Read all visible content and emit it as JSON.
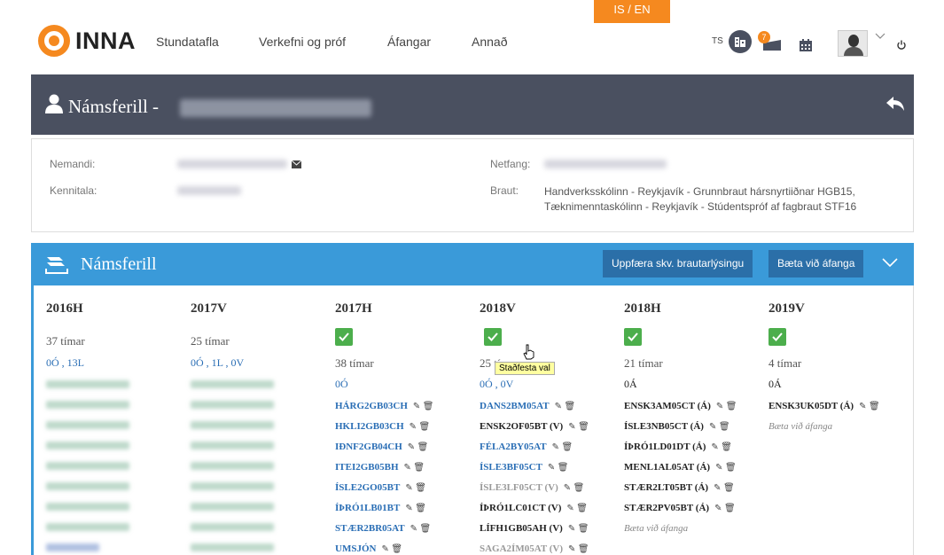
{
  "lang_switch": "IS / EN",
  "app": {
    "logo_text": "INNA"
  },
  "nav": [
    "Stundatafla",
    "Verkefni og próf",
    "Áfangar",
    "Annað"
  ],
  "topbar": {
    "ts_label": "TS",
    "notif_count": "7"
  },
  "header": {
    "title": "Námsferill -"
  },
  "info": {
    "nemandi_label": "Nemandi:",
    "kennitala_label": "Kennitala:",
    "netfang_label": "Netfang:",
    "braut_label": "Braut:",
    "braut_value_1": "Handverksskólinn - Reykjavík - Grunnbraut hársnyrtiiðnar HGB15,",
    "braut_value_2": "Tæknimenntaskólinn - Reykjavík - Stúdentspróf af fagbraut STF16"
  },
  "panel": {
    "title": "Námsferill",
    "update_button": "Uppfæra skv. brautarlýsingu",
    "add_button": "Bæta við áfanga"
  },
  "columns": [
    {
      "year": "2016H",
      "hours": "37 tímar",
      "counts": "0Ó , 13L"
    },
    {
      "year": "2017V",
      "hours": "25 tímar",
      "counts": "0Ó , 1L , 0V"
    },
    {
      "year": "2017H",
      "hours": "38 tímar",
      "counts": "0Ó",
      "courses": [
        "HÁRG2GB03CH",
        "HKLI2GB03CH",
        "IÐNF2GB04CH",
        "ITEI2GB05BH",
        "ÍSLE2GO05BT",
        "ÍÞRÓ1LB01BT",
        "STÆR2BR05AT",
        "UMSJÓN"
      ]
    },
    {
      "year": "2018V",
      "hours": "25 tímar",
      "counts": "0Ó , 0V",
      "courses": [
        "DANS2BM05AT",
        "ENSK2OF05BT (V)",
        "FÉLA2BY05AT",
        "ÍSLE3BF05CT",
        "ÍSLE3LF05CT (V)",
        "ÍÞRÓ1LC01CT (V)",
        "LÍFH1GB05AH (V)",
        "SAGA2ÍM05AT (V)"
      ]
    },
    {
      "year": "2018H",
      "hours": "21 tímar",
      "counts": "0Á",
      "courses": [
        "ENSK3AM05CT (Á)",
        "ÍSLE3NB05CT (Á)",
        "ÍÞRÓ1LD01DT (Á)",
        "MENL1AL05AT (Á)",
        "STÆR2LT05BT (Á)",
        "STÆR2PV05BT (Á)"
      ],
      "add_more": "Bæta við áfanga"
    },
    {
      "year": "2019V",
      "hours": "4 tímar",
      "counts": "0Á",
      "courses": [
        "ENSK3UK05DT (Á)"
      ],
      "add_more": "Bæta við áfanga"
    }
  ],
  "tooltip": "Staðfesta val",
  "colors": {
    "orange": "#f5891f",
    "header_dark": "#4a5060",
    "panel_blue": "#3a9ad9",
    "button_blue": "#2b6fa8",
    "check_green": "#4cae4c",
    "course_blue": "#2a6eb5"
  }
}
